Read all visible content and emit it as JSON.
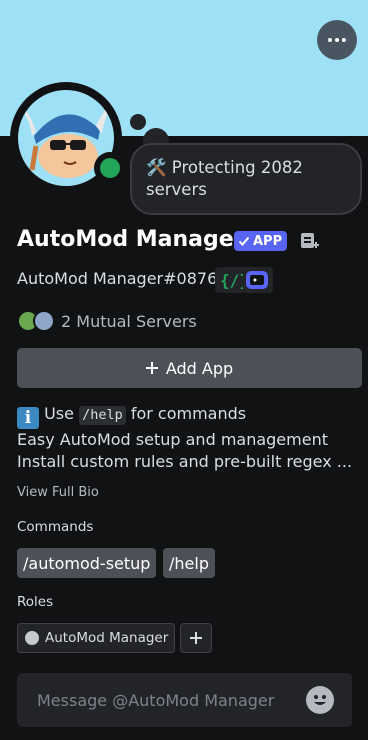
{
  "profile": {
    "status_text": "🛠️ Protecting 2082 servers",
    "display_name": "AutoMod Manager",
    "app_badge_label": "APP",
    "username": "AutoMod Manager#0876",
    "mutual_servers_label": "2 Mutual Servers",
    "add_app_label": "Add App"
  },
  "bio": {
    "use_prefix": "Use",
    "help_code": "/help",
    "use_suffix": "for commands",
    "line2": "Easy AutoMod setup and management",
    "line3": "Install custom rules and pre-built regex ...",
    "view_full_label": "View Full Bio"
  },
  "commands": {
    "title": "Commands",
    "items": [
      "/automod-setup",
      "/help"
    ]
  },
  "roles": {
    "title": "Roles",
    "items": [
      "AutoMod Manager"
    ]
  },
  "message": {
    "placeholder": "Message @AutoMod Manager"
  },
  "colors": {
    "banner": "#9ee1f7",
    "online": "#23a55a",
    "app_badge": "#5865f2"
  }
}
